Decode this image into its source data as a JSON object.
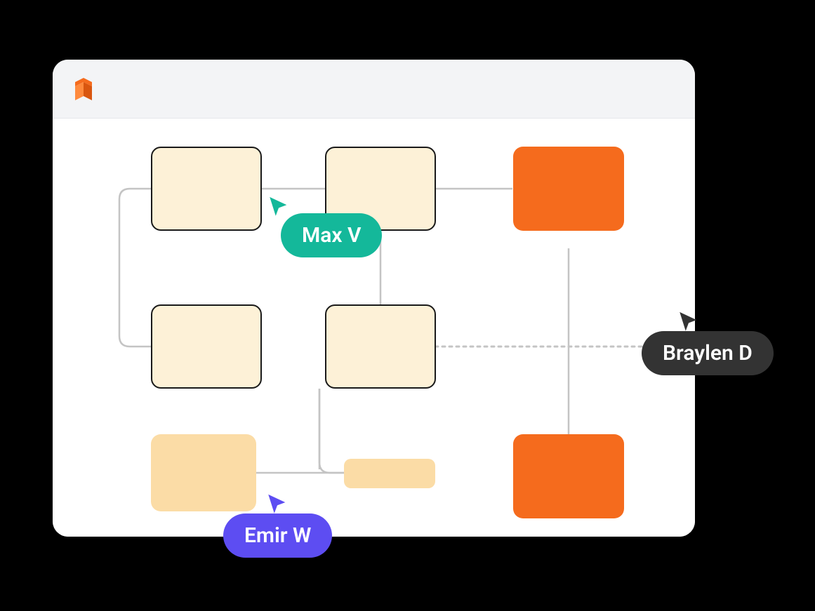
{
  "cursors": {
    "max": {
      "label": "Max V",
      "color": "#14b89a"
    },
    "emir": {
      "label": "Emir W",
      "color": "#5d4df2"
    },
    "braylen": {
      "label": "Braylen D",
      "color": "#333333"
    }
  },
  "colors": {
    "cream": "#fdf1d7",
    "orange": "#f56b1d",
    "peach": "#fbdca6",
    "window_bg": "#ffffff",
    "titlebar_bg": "#f3f4f6",
    "connector": "#c4c4c4"
  }
}
